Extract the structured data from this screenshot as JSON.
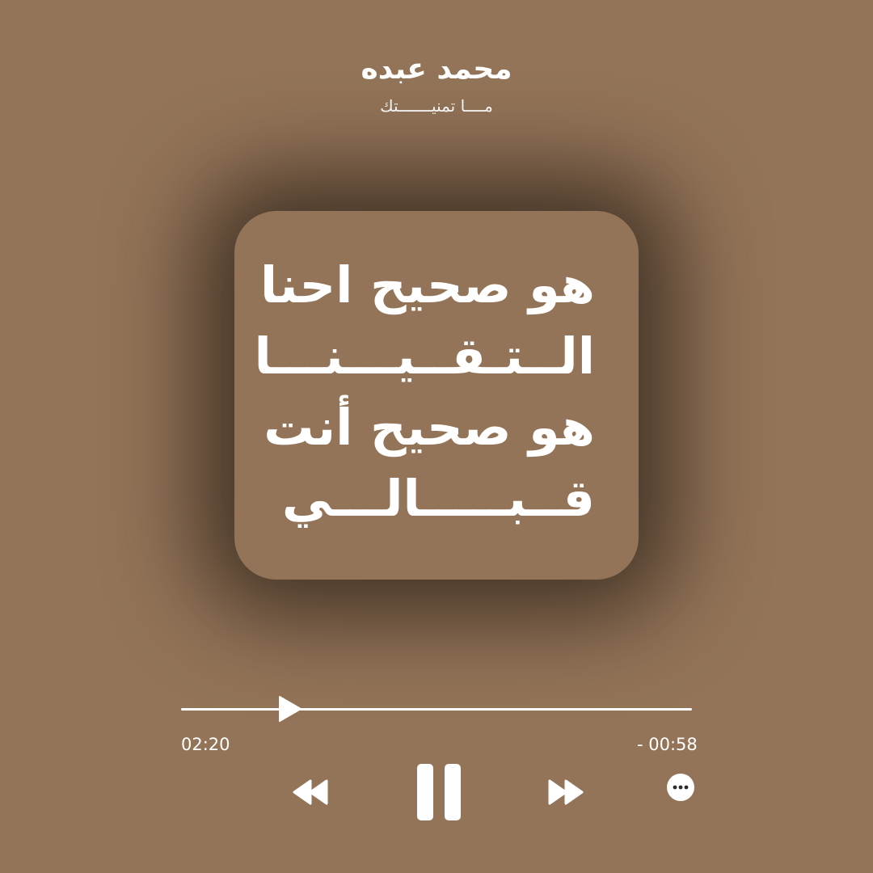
{
  "header": {
    "artist": "محمد عبده",
    "song_title": "مــــا تمنيـــــــتك"
  },
  "lyrics_card": {
    "lines": [
      "هو صحيح احنا",
      "الــتـقــيـــنـــا",
      "هو صحيح أنت",
      "قــبـــــالـــي"
    ]
  },
  "player": {
    "progress_fraction": 0.2,
    "time_elapsed": "02:20",
    "time_remaining": "- 00:58",
    "controls": {
      "previous_icon": "rewind-icon",
      "play_pause_icon": "pause-icon",
      "next_icon": "fast-forward-icon",
      "more_icon": "more-options-icon"
    }
  },
  "colors": {
    "background": "#937458",
    "foreground": "#ffffff",
    "card_shadow": "#3a2b20"
  }
}
